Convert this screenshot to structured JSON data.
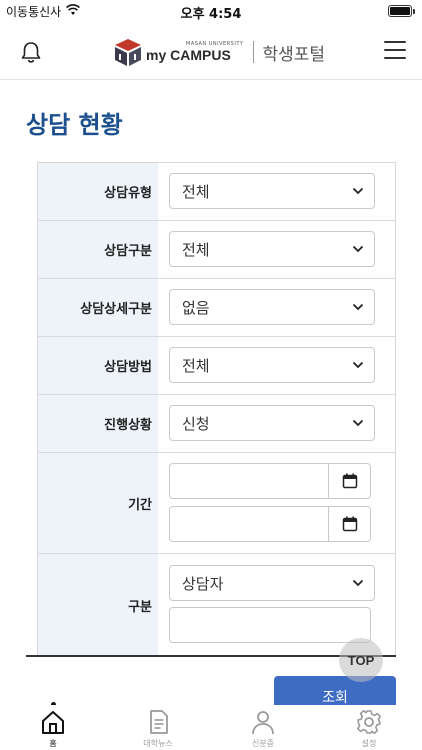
{
  "status_bar": {
    "carrier": "이동통신사",
    "time": "오후 4:54"
  },
  "header": {
    "logo_university": "MASAN UNIVERSITY",
    "logo_campus": "my CAMPUS",
    "portal_label": "학생포털"
  },
  "page": {
    "title": "상담 현황"
  },
  "form": {
    "type": {
      "label": "상담유형",
      "value": "전체"
    },
    "category": {
      "label": "상담구분",
      "value": "전체"
    },
    "detail": {
      "label": "상담상세구분",
      "value": "없음"
    },
    "method": {
      "label": "상담방법",
      "value": "전체"
    },
    "status": {
      "label": "진행상황",
      "value": "신청"
    },
    "period": {
      "label": "기간",
      "start": "",
      "end": ""
    },
    "division": {
      "label": "구분",
      "value": "상담자",
      "keyword": ""
    }
  },
  "buttons": {
    "top": "TOP",
    "search": "조회"
  },
  "tabbar": {
    "items": [
      {
        "label": "홈",
        "icon": "home-icon",
        "active": true
      },
      {
        "label": "대학뉴스",
        "icon": "news-icon",
        "active": false
      },
      {
        "label": "신분증",
        "icon": "id-card-icon",
        "active": false
      },
      {
        "label": "설정",
        "icon": "settings-icon",
        "active": false
      }
    ]
  },
  "colors": {
    "title": "#1b4f8d",
    "label_bg": "#eef3f9",
    "search_button": "#3e6cc3"
  }
}
